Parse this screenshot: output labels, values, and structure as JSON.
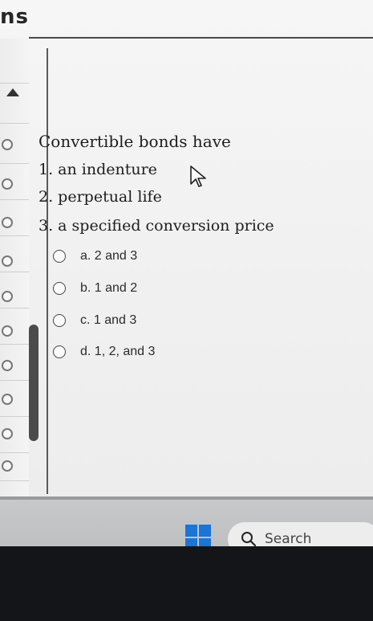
{
  "window": {
    "title_fragment": "ns"
  },
  "question": {
    "stem": "Convertible bonds have",
    "statements": [
      "1. an indenture",
      "2. perpetual life",
      "3. a specified conversion price"
    ],
    "options": [
      {
        "label": "a. 2 and 3"
      },
      {
        "label": "b. 1 and 2"
      },
      {
        "label": "c. 1 and 3"
      },
      {
        "label": "d. 1, 2, and 3"
      }
    ]
  },
  "taskbar": {
    "search_label": "Search",
    "icons": [
      "windows-start-icon",
      "search-icon"
    ]
  },
  "colors": {
    "windows_blue": "#1b74d8",
    "background": "#f3f3f3"
  }
}
